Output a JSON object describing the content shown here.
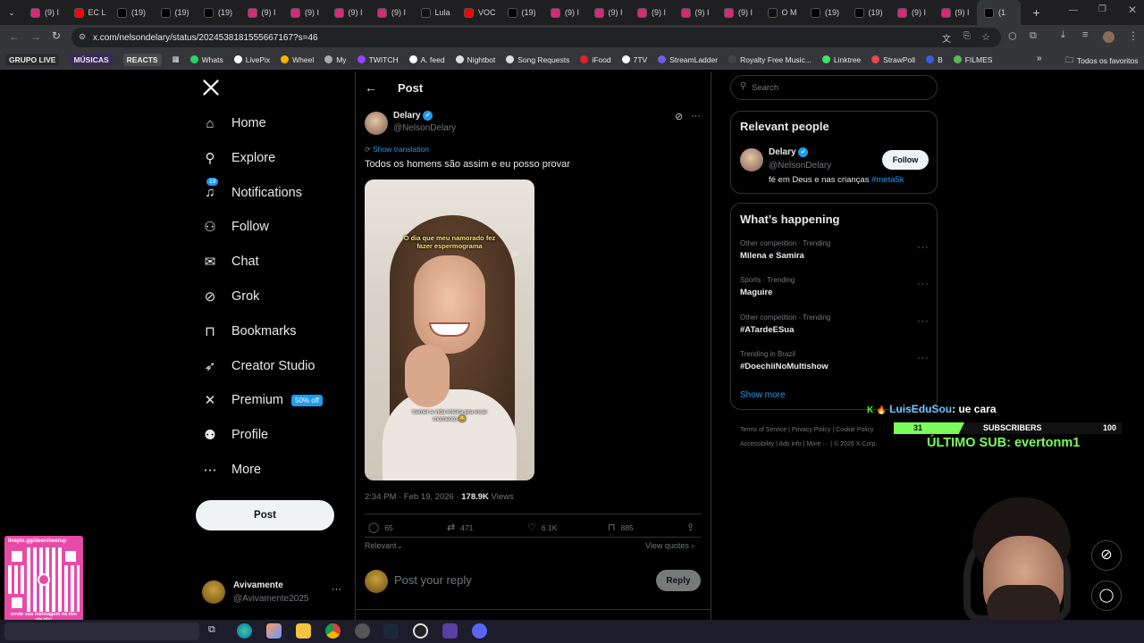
{
  "browser": {
    "tabs": [
      {
        "icon": "instagram-icon",
        "label": "(9) I",
        "color": "#d62976"
      },
      {
        "icon": "youtube-icon",
        "label": "EC L",
        "color": "#ff0000"
      },
      {
        "icon": "x-icon",
        "label": "(19)",
        "color": "#000000"
      },
      {
        "icon": "x-icon",
        "label": "(19)",
        "color": "#000000"
      },
      {
        "icon": "x-icon",
        "label": "(19)",
        "color": "#000000"
      },
      {
        "icon": "instagram-icon",
        "label": "(9) I",
        "color": "#d62976"
      },
      {
        "icon": "instagram-icon",
        "label": "(9) I",
        "color": "#d62976"
      },
      {
        "icon": "instagram-icon",
        "label": "(9) I",
        "color": "#d62976"
      },
      {
        "icon": "instagram-icon",
        "label": "(9) I",
        "color": "#d62976"
      },
      {
        "icon": "tiktok-icon",
        "label": "Lula",
        "color": "#111111"
      },
      {
        "icon": "youtube-icon",
        "label": "VOC",
        "color": "#ff0000"
      },
      {
        "icon": "x-icon",
        "label": "(19)",
        "color": "#000000"
      },
      {
        "icon": "instagram-icon",
        "label": "(9) I",
        "color": "#d62976"
      },
      {
        "icon": "instagram-icon",
        "label": "(9) I",
        "color": "#d62976"
      },
      {
        "icon": "instagram-icon",
        "label": "(9) I",
        "color": "#d62976"
      },
      {
        "icon": "instagram-icon",
        "label": "(9) I",
        "color": "#d62976"
      },
      {
        "icon": "instagram-icon",
        "label": "(9) I",
        "color": "#d62976"
      },
      {
        "icon": "tiktok-icon",
        "label": "O M",
        "color": "#111111"
      },
      {
        "icon": "x-icon",
        "label": "(19)",
        "color": "#000000"
      },
      {
        "icon": "x-icon",
        "label": "(19)",
        "color": "#000000"
      },
      {
        "icon": "instagram-icon",
        "label": "(9) I",
        "color": "#d62976"
      },
      {
        "icon": "instagram-icon",
        "label": "(9) I",
        "color": "#d62976"
      },
      {
        "icon": "x-icon",
        "label": "(1",
        "color": "#000000",
        "active": true
      }
    ],
    "url": "x.com/nelsondelary/status/2024538181555667167?s=46",
    "bookmarks": [
      {
        "label": "GRUPO LIVE",
        "pill": true,
        "color": "#2b2b2b"
      },
      {
        "label": "MÚSICAS",
        "pill": true,
        "color": "#3a2a55"
      },
      {
        "label": "REACTS",
        "pill": true,
        "color": "#4a4a4a"
      },
      {
        "label": "Whats",
        "color": "#25d366"
      },
      {
        "label": "LivePix",
        "color": "#ffffff"
      },
      {
        "label": "Wheel",
        "color": "#f4b400"
      },
      {
        "label": "My",
        "color": "#aaaaaa"
      },
      {
        "label": "TWITCH",
        "color": "#9146ff"
      },
      {
        "label": "A. feed",
        "color": "#ffffff"
      },
      {
        "label": "Nightbot",
        "color": "#dddddd"
      },
      {
        "label": "Song Requests",
        "color": "#dddddd"
      },
      {
        "label": "iFood",
        "color": "#ea1d2c"
      },
      {
        "label": "7TV",
        "color": "#ffffff"
      },
      {
        "label": "StreamLadder",
        "color": "#6c5ce7"
      },
      {
        "label": "Royalty Free Music...",
        "color": "#444444"
      },
      {
        "label": "Linktree",
        "color": "#43e660"
      },
      {
        "label": "StrawPoll",
        "color": "#e64a4a"
      },
      {
        "label": "B",
        "color": "#3b5bdb"
      },
      {
        "label": "FILMES",
        "color": "#5cb85c"
      }
    ],
    "all_bookmarks": "Todos os favoritos"
  },
  "nav": {
    "items": [
      {
        "label": "Home",
        "icon": "home-icon"
      },
      {
        "label": "Explore",
        "icon": "search-icon"
      },
      {
        "label": "Notifications",
        "icon": "bell-icon",
        "badge": "19"
      },
      {
        "label": "Follow",
        "icon": "person-add-icon"
      },
      {
        "label": "Chat",
        "icon": "mail-icon"
      },
      {
        "label": "Grok",
        "icon": "grok-icon"
      },
      {
        "label": "Bookmarks",
        "icon": "bookmark-icon"
      },
      {
        "label": "Creator Studio",
        "icon": "rocket-icon"
      },
      {
        "label": "Premium",
        "icon": "x-icon",
        "badge": "50% off"
      },
      {
        "label": "Profile",
        "icon": "person-icon"
      },
      {
        "label": "More",
        "icon": "more-circle-icon"
      }
    ],
    "post_button": "Post",
    "account": {
      "name": "Avivamente",
      "handle": "@Avivamente2025"
    }
  },
  "post": {
    "header_title": "Post",
    "author_name": "Delary",
    "author_handle": "@NelsonDelary",
    "show_translation": "Show translation",
    "text": "Todos os homens são assim e eu posso provar",
    "video_caption_top": "O dia que meu namorado fez fazer espermograma",
    "video_caption_bottom": "tremei a vida inteira pra esse momento 😂",
    "timestamp": "2:34 PM · Feb 19, 2026 · ",
    "views_count": "178.9K",
    "views_label": "Views",
    "replies": "65",
    "reposts": "471",
    "likes": "6.1K",
    "bookmarks": "885",
    "sort_label": "Relevant",
    "view_quotes": "View quotes",
    "reply_placeholder": "Post your reply",
    "reply_button": "Reply"
  },
  "sidebar": {
    "search_placeholder": "Search",
    "relevant_title": "Relevant people",
    "person_name": "Delary",
    "person_handle": "@NelsonDelary",
    "person_bio": "fé em Deus e nas crianças ",
    "person_bio_tag": "#meta5k",
    "follow_button": "Follow",
    "happening_title": "What’s happening",
    "trends": [
      {
        "meta": "Other competition · Trending",
        "name": "Milena e Samira"
      },
      {
        "meta": "Sports · Trending",
        "name": "Maguire"
      },
      {
        "meta": "Other competition · Trending",
        "name": "#ATardeESua"
      },
      {
        "meta": "Trending in Brazil",
        "name": "#DoechiiNoMultishow"
      }
    ],
    "show_more": "Show more",
    "footer_line1": [
      "Terms of Service",
      "Privacy Policy",
      "Cookie Policy"
    ],
    "footer_line2": [
      "Accessibility",
      "Ads info",
      "More ···",
      "© 2026 X Corp."
    ]
  },
  "stream_overlay": {
    "chat_user": "LuisEduSou",
    "chat_message": ": ue cara",
    "sub_count": "31",
    "sub_label": "SUBSCRIBERS",
    "sub_goal": "100",
    "last_sub": "ÚLTIMO SUB: evertonm1",
    "qr_url": "livepix.gg/deercheerup",
    "qr_caption": "envie sua mensagem na live via pix!"
  },
  "colors": {
    "accent": "#1d9bf0",
    "background": "#000000",
    "border": "#2f3336",
    "muted": "#71767b",
    "overlay_green": "#7CFC5A"
  }
}
